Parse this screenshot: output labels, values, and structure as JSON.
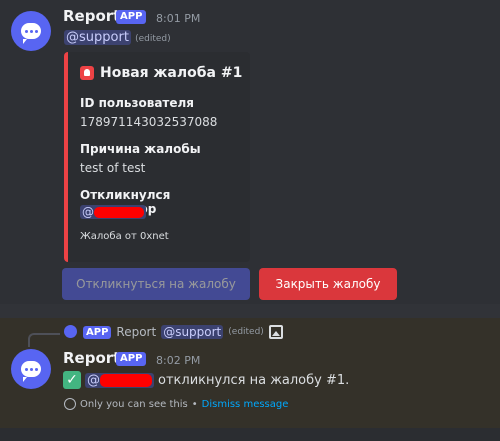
{
  "message1": {
    "username": "Report",
    "badge": "APP",
    "timestamp": "8:01 PM",
    "mention": "@support",
    "edited": "(edited)",
    "embed": {
      "title": "Новая жалоба #1",
      "fields": [
        {
          "name": "ID пользователя",
          "value": "178971143032537088"
        },
        {
          "name": "Причина жалобы",
          "value": "test of test"
        },
        {
          "name": "Откликнулся модератор",
          "value": "@"
        }
      ],
      "footer": "Жалоба от 0xnet",
      "accent_color": "#ed4245"
    },
    "buttons": {
      "respond_label": "Откликнуться на жалобу",
      "close_label": "Закрыть жалобу"
    }
  },
  "reply_reference": {
    "badge": "APP",
    "username": "Report",
    "mention": "@support",
    "edited": "(edited)"
  },
  "message2": {
    "username": "Report",
    "badge": "APP",
    "timestamp": "8:02 PM",
    "text_prefix": "@",
    "text": "откликнулся на жалобу #1.",
    "ephemeral_note": "Only you can see this",
    "separator": "•",
    "dismiss_label": "Dismiss message"
  }
}
